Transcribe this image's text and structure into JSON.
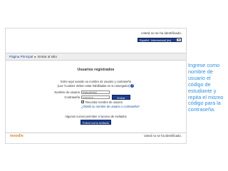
{
  "header": {
    "not_identified": "Usted no se ha identificado.",
    "language": "Español - Internacional (es)"
  },
  "navbar": {
    "home": "Página Principal",
    "separator": "▸",
    "current": "Entrar al sitio"
  },
  "login": {
    "title": "Usuarios registrados",
    "instruction": "Entre aquí usando su nombre de usuario y contraseña",
    "cookies_note": "(Las 'Cookies' deben estar habilitadas en su navegador)",
    "username_label": "Nombre de usuario",
    "username_value": "6/abcdef4a3",
    "password_label": "Contraseña",
    "password_value": "••••••••••••",
    "submit_label": "Entrar",
    "remember_label": "Recordar nombre de usuario",
    "forgot_link": "¿Olvidó su nombre de usuario o contraseña?",
    "guest_note": "Algunos cursos permiten el acceso de invitados",
    "guest_button": "Entrar como invitado"
  },
  "footer": {
    "logo": "moodle",
    "not_identified": "Usted no se ha identificado."
  },
  "side_note": {
    "lines": [
      "Ingrese como",
      "nombre de",
      "usuario el",
      "código de",
      "estudiante y",
      "repita el mismo",
      "código para la",
      "contraseña."
    ]
  },
  "colors": {
    "accent": "#2f8fe0",
    "button": "#1f3f8a",
    "link": "#1a48a0"
  }
}
